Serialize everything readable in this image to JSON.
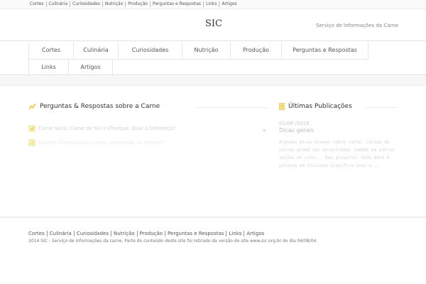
{
  "top_menu": [
    "Cortes",
    "Culinária",
    "Curiosidades",
    "Nutrição",
    "Produção",
    "Perguntas e Respostas",
    "Links",
    "Artigos"
  ],
  "header": {
    "title": "SIC",
    "tagline": "Serviço de Informações da Carne"
  },
  "nav": {
    "row1": [
      "Cortes",
      "Culinária",
      "Curiosidades",
      "Nutrição",
      "Produção",
      "Perguntas e Respostas"
    ],
    "row2": [
      "Links",
      "Artigos"
    ]
  },
  "qa_section": {
    "title": "Perguntas & Respostas sobre a Carne",
    "items": [
      "Carne Seca, Carne de Sol e Charque. Qual a Diferença?",
      "Quanto tempo dura a carne congelada no freezer?"
    ]
  },
  "latest_section": {
    "title": "Últimas Publicações",
    "post": {
      "date": "01/06 /2016",
      "title": "Dicas gerais",
      "excerpt": "Algumas dicas breves sobre carne, várias de outras podem ser encontradas também em outras seções do site... Bom proveito! OSSO BUCO A palavra em italiano significa osso e ..."
    }
  },
  "footer": {
    "links": [
      "Cortes",
      "Culinária",
      "Curiosidades",
      "Nutrição",
      "Produção",
      "Perguntas e Respostas",
      "Links",
      "Artigos"
    ],
    "copyright": "2014 SIC - Serviço de informações da carne. Parte do conteúdo deste site foi retirado da versão do site www.sic.org.br do dia 04/08/04."
  },
  "colors": {
    "accent": "#e6c84a",
    "check_bg": "#f3efb9"
  }
}
